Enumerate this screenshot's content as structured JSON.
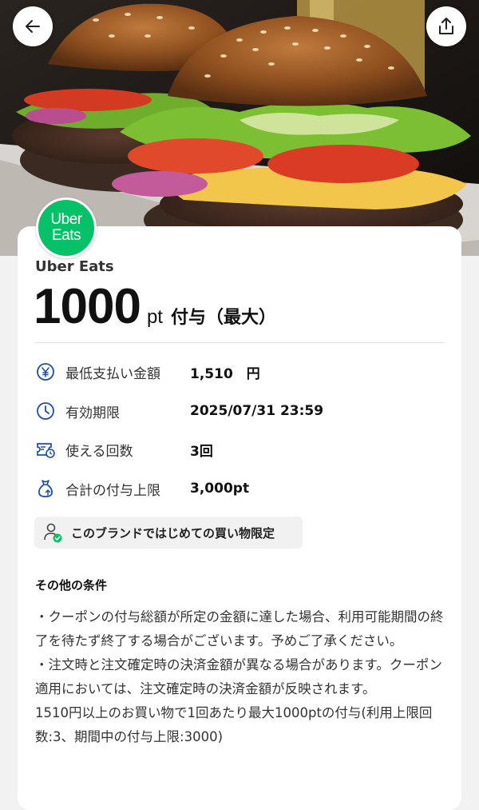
{
  "header": {
    "back_icon": "arrow-left-icon",
    "share_icon": "share-upload-icon"
  },
  "brand": {
    "logo_line1": "Uber",
    "logo_line2": "Eats",
    "logo_color": "#06c167",
    "name": "Uber Eats"
  },
  "offer": {
    "amount": "1000",
    "unit": "pt",
    "suffix": "付与（最大）"
  },
  "details": [
    {
      "icon": "yen-icon",
      "label": "最低支払い金額",
      "value": "1,510　円"
    },
    {
      "icon": "clock-icon",
      "label": "有効期限",
      "value": "2025/07/31 23:59"
    },
    {
      "icon": "ticket-icon",
      "label": "使える回数",
      "value": "3回"
    },
    {
      "icon": "money-bag-icon",
      "label": "合計の付与上限",
      "value": "3,000pt"
    }
  ],
  "badge": {
    "icon": "user-check-icon",
    "text": "このブランドではじめての買い物限定"
  },
  "conditions": {
    "title": "その他の条件",
    "paragraphs": [
      "・クーポンの付与総額が所定の金額に達した場合、利用可能期間の終了を待たず終了する場合がございます。予めご了承ください。",
      "・注文時と注文確定時の決済金額が異なる場合があります。クーポン適用においては、注文確定時の決済金額が反映されます。",
      "1510円以上のお買い物で1回あたり最大1000ptの付与(利用上限回数:3、期間中の付与上限:3000)"
    ]
  }
}
